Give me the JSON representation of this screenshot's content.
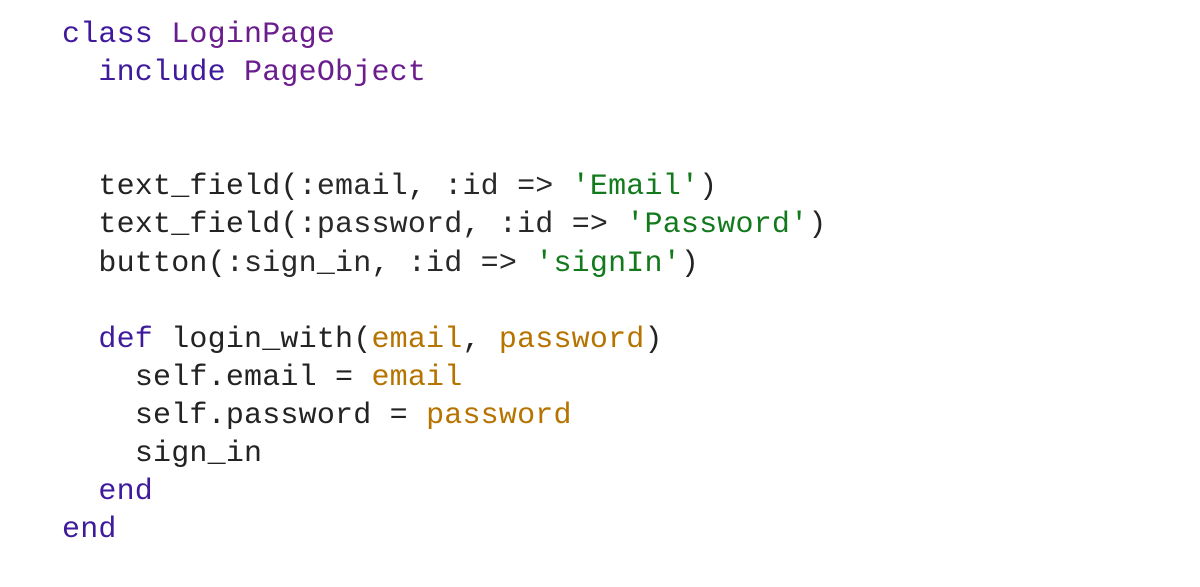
{
  "line1": {
    "kw": "class",
    "name": "LoginPage"
  },
  "line2": {
    "kw": "include",
    "mod": "PageObject"
  },
  "line5": {
    "call": "text_field",
    "sym1": ":email",
    "sym2": ":id",
    "arrow": "=>",
    "str": "'Email'"
  },
  "line6": {
    "call": "text_field",
    "sym1": ":password",
    "sym2": ":id",
    "arrow": "=>",
    "str": "'Password'"
  },
  "line7": {
    "call": "button",
    "sym1": ":sign_in",
    "sym2": ":id",
    "arrow": "=>",
    "str": "'signIn'"
  },
  "line9": {
    "kw": "def",
    "name": "login_with",
    "p1": "email",
    "p2": "password"
  },
  "line10": {
    "lhs": "self.email",
    "eq": "=",
    "rhs": "email"
  },
  "line11": {
    "lhs": "self.password",
    "eq": "=",
    "rhs": "password"
  },
  "line12": {
    "call": "sign_in"
  },
  "end": "end"
}
